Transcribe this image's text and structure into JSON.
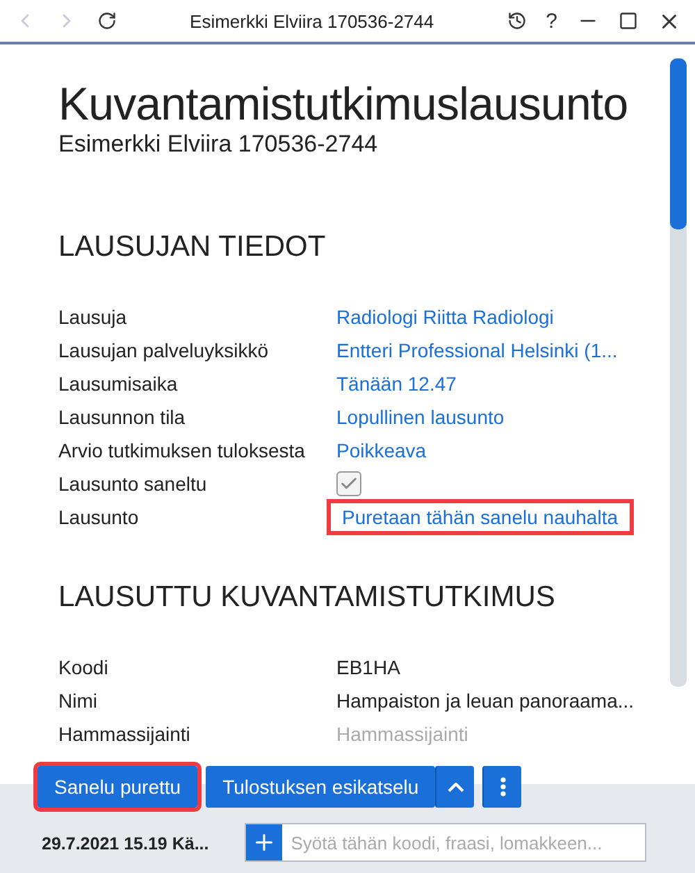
{
  "window": {
    "title": "Esimerkki Elviira 170536-2744",
    "help": "?"
  },
  "page": {
    "title": "Kuvantamistutkimuslausunto",
    "subtitle": "Esimerkki Elviira 170536-2744"
  },
  "sections": [
    {
      "heading": "LAUSUJAN TIEDOT",
      "rows": [
        {
          "label": "Lausuja",
          "kind": "link",
          "value": "Radiologi Riitta Radiologi",
          "highlighted": false
        },
        {
          "label": "Lausujan palveluyksikkö",
          "kind": "link",
          "value": "Entteri Professional Helsinki (1...",
          "highlighted": false
        },
        {
          "label": "Lausumisaika",
          "kind": "link",
          "value": "Tänään 12.47",
          "highlighted": false
        },
        {
          "label": "Lausunnon tila",
          "kind": "link",
          "value": "Lopullinen lausunto",
          "highlighted": false
        },
        {
          "label": "Arvio tutkimuksen tuloksesta",
          "kind": "link",
          "value": "Poikkeava",
          "highlighted": false
        },
        {
          "label": "Lausunto saneltu",
          "kind": "checkbox",
          "checked": true
        },
        {
          "label": "Lausunto",
          "kind": "link",
          "value": "Puretaan tähän sanelu nauhalta",
          "highlighted": true
        }
      ]
    },
    {
      "heading": "LAUSUTTU KUVANTAMISTUTKIMUS",
      "rows": [
        {
          "label": "Koodi",
          "kind": "text",
          "value": "EB1HA"
        },
        {
          "label": "Nimi",
          "kind": "text",
          "value": "Hampaiston ja leuan panoraama..."
        },
        {
          "label": "Hammassijainti",
          "kind": "placeholder",
          "placeholder": "Hammassijainti"
        }
      ]
    }
  ],
  "actions": {
    "primary": {
      "label": "Sanelu purettu",
      "highlighted": true
    },
    "preview": {
      "label": "Tulostuksen esikatselu"
    }
  },
  "footer": {
    "timestamp": "29.7.2021 15.19 Kä...",
    "input": {
      "placeholder": "Syötä tähän koodi, fraasi, lomakkeen..."
    }
  }
}
